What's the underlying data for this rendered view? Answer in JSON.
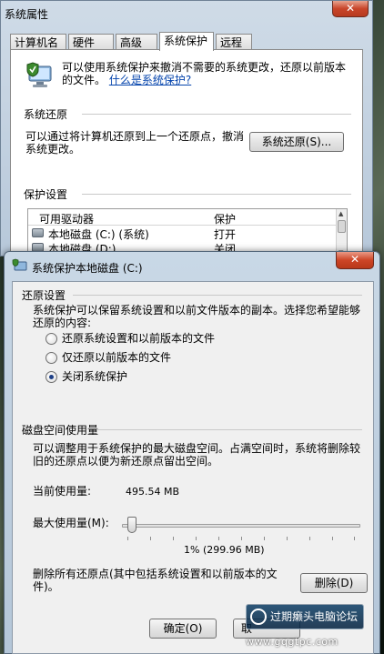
{
  "sysprop": {
    "title": "系统属性",
    "close": "✕",
    "tabs": [
      "计算机名",
      "硬件",
      "高级",
      "系统保护",
      "远程"
    ],
    "active_tab": "系统保护",
    "intro_text": "可以使用系统保护来撤消不需要的系统更改，还原以前版本的文件。",
    "intro_link": "什么是系统保护?",
    "restore_group": "系统还原",
    "restore_desc": "可以通过将计算机还原到上一个还原点，撤消系统更改。",
    "restore_button": "系统还原(S)...",
    "settings_group": "保护设置",
    "drives_headers": [
      "可用驱动器",
      "保护"
    ],
    "drives": [
      {
        "name": "本地磁盘 (C:) (系统)",
        "protection": "打开"
      },
      {
        "name": "本地磁盘 (D:)",
        "protection": "关闭"
      }
    ]
  },
  "protect": {
    "title": "系统保护本地磁盘 (C:)",
    "close": "✕",
    "restore_settings_group": "还原设置",
    "restore_settings_desc": "系统保护可以保留系统设置和以前文件版本的副本。选择您希望能够还原的内容:",
    "options": [
      {
        "label": "还原系统设置和以前版本的文件",
        "checked": false
      },
      {
        "label": "仅还原以前版本的文件",
        "checked": false
      },
      {
        "label": "关闭系统保护",
        "checked": true
      }
    ],
    "disk_usage_group": "磁盘空间使用量",
    "disk_usage_desc": "可以调整用于系统保护的最大磁盘空间。占满空间时，系统将删除较旧的还原点以便为新还原点留出空间。",
    "current_usage_label": "当前使用量:",
    "current_usage_value": "495.54 MB",
    "max_usage_label": "最大使用量(M):",
    "max_usage_fraction": 0.01,
    "max_usage_readout": "1% (299.96 MB)",
    "delete_desc": "删除所有还原点(其中包括系统设置和以前版本的文件)。",
    "delete_button": "删除(D)",
    "ok_button": "确定(O)",
    "cancel_button_partial": "取"
  },
  "watermark": {
    "text": "过期癞头电脑论坛",
    "url": "www.gqgtpc.com"
  },
  "colors": {
    "link": "#0645ad",
    "close_red": "#c8452a",
    "title_bar": "#b7c8da"
  }
}
